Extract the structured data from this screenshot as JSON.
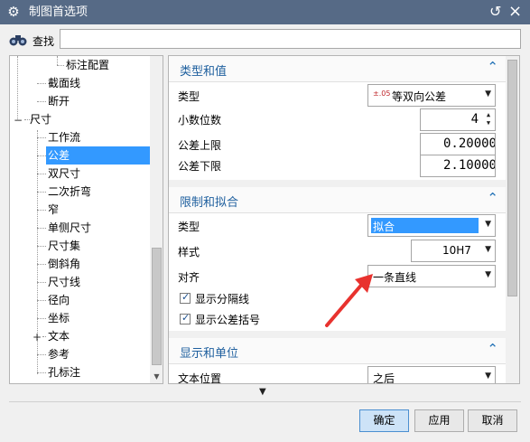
{
  "window": {
    "title": "制图首选项",
    "title_icon": "gear-icon"
  },
  "find": {
    "label": "查找",
    "value": ""
  },
  "tree": {
    "items": [
      {
        "label": "标注配置",
        "selected": false
      },
      {
        "label": "截面线",
        "selected": false
      },
      {
        "label": "断开",
        "selected": false
      },
      {
        "label": "尺寸",
        "selected": false,
        "expander": "−"
      },
      {
        "label": "工作流",
        "selected": false
      },
      {
        "label": "公差",
        "selected": true
      },
      {
        "label": "双尺寸",
        "selected": false
      },
      {
        "label": "二次折弯",
        "selected": false
      },
      {
        "label": "窄",
        "selected": false
      },
      {
        "label": "单侧尺寸",
        "selected": false
      },
      {
        "label": "尺寸集",
        "selected": false
      },
      {
        "label": "倒斜角",
        "selected": false
      },
      {
        "label": "尺寸线",
        "selected": false
      },
      {
        "label": "径向",
        "selected": false
      },
      {
        "label": "坐标",
        "selected": false
      },
      {
        "label": "文本",
        "selected": false,
        "expander": "+"
      },
      {
        "label": "参考",
        "selected": false
      },
      {
        "label": "孔标注",
        "selected": false
      }
    ]
  },
  "sections": {
    "type_value": {
      "title": "类型和值",
      "type_label": "类型",
      "type_value": "等双向公差",
      "type_icon_text": "±.05",
      "decimals_label": "小数位数",
      "decimals_value": "4",
      "upper_label": "公差上限",
      "upper_value": "0.20000",
      "lower_label": "公差下限",
      "lower_value": "2.10000"
    },
    "limits_fits": {
      "title": "限制和拟合",
      "type_label": "类型",
      "type_value": "拟合",
      "style_label": "样式",
      "style_value": "10H7",
      "align_label": "对齐",
      "align_value": "一条直线",
      "chk_separator_label": "显示分隔线",
      "chk_separator_checked": true,
      "chk_brackets_label": "显示公差括号",
      "chk_brackets_checked": true
    },
    "display_units": {
      "title": "显示和单位",
      "text_pos_label": "文本位置",
      "text_pos_value": "之后"
    }
  },
  "buttons": {
    "ok": "确定",
    "apply": "应用",
    "cancel": "取消"
  },
  "colors": {
    "titlebar": "#566a86",
    "selection": "#3399ff",
    "section_title": "#1e5f9e",
    "annotation_arrow": "#e8322e"
  }
}
